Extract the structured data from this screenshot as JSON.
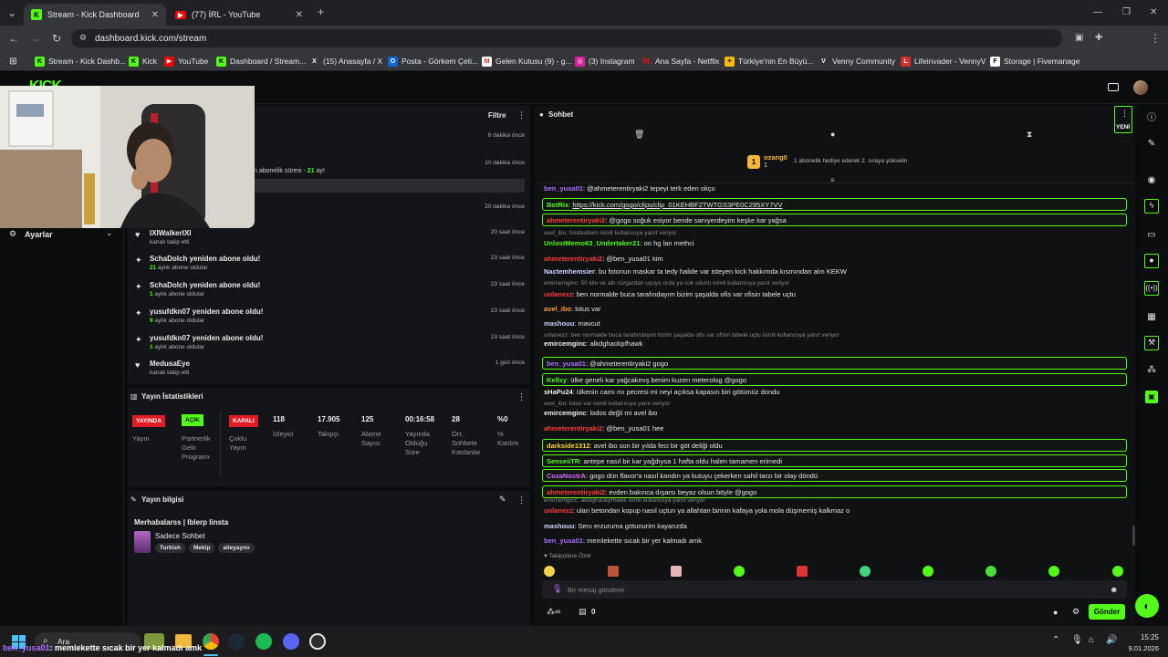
{
  "tabs": [
    {
      "title": "Stream - Kick Dashboard",
      "active": true
    },
    {
      "title": "(77) İRL - YouTube",
      "active": false
    }
  ],
  "address": "dashboard.kick.com/stream",
  "bookmarks": [
    "Stream - Kick Dashb...",
    "Kick",
    "YouTube",
    "Dashboard / Stream...",
    "(15) Anasayfa / X",
    "Posta - Görkem Çeti...",
    "Gelen Kutusu (9) - g...",
    "(3) Instagram",
    "Ana Sayfa - Netflix",
    "Türkiye'nin En Büyü...",
    "Venny Community",
    "Lifeinvader - VennyV",
    "Storage | Fivemanage"
  ],
  "sidebar": {
    "settings_label": "Ayarlar"
  },
  "activity": {
    "filter_label": "Filtre",
    "rows": [
      {
        "time": "6 dakika önce"
      },
      {
        "sub_prefix": "n abonelik süresi - ",
        "sub_num": "21",
        "sub_suffix": " ay!",
        "time": "10 dakika önce"
      },
      {
        "time": "20 dakika önce"
      },
      {
        "title": "IXIWalkerIXI",
        "sub": "kanalı takip etti",
        "time": "20 saat önce"
      },
      {
        "title": "SchaDolch yeniden abone oldu!",
        "sub_num": "21",
        "sub": " aylık abone oldular",
        "time": "23 saat önce"
      },
      {
        "title": "SchaDolch yeniden abone oldu!",
        "sub_num": "1",
        "sub": " aylık abone oldular",
        "time": "23 saat önce"
      },
      {
        "title": "yusufdkn07 yeniden abone oldu!",
        "sub_num": "9",
        "sub": " aylık abone oldular",
        "time": "23 saat önce"
      },
      {
        "title": "yusufdkn07 yeniden abone oldu!",
        "sub_num": "1",
        "sub": " aylık abone oldular",
        "time": "23 saat önce"
      },
      {
        "title": "MedusaEye",
        "sub": "kanalı takip etti",
        "time": "1 gün önce"
      }
    ]
  },
  "stats": {
    "title": "Yayın İstatistikleri",
    "badges": {
      "live": "YAYINDA",
      "partner": "AÇIK",
      "multi": "KAPALI"
    },
    "labels": {
      "stream": "Yayın",
      "partner": "Partnerlik Gelir Programı",
      "multi": "Çoklu Yayın"
    },
    "values": [
      {
        "num": "118",
        "label": "İzleyici"
      },
      {
        "num": "17.905",
        "label": "Takipçi"
      },
      {
        "num": "125",
        "label": "Abone Sayısı"
      },
      {
        "num": "00:16:58",
        "label": "Yayında Olduğu Süre"
      },
      {
        "num": "28",
        "label": "Ort. Sohbete Katılanlar"
      },
      {
        "num": "%0",
        "label": "% Katılım"
      }
    ]
  },
  "info": {
    "title": "Yayın bilgisi",
    "stream_title": "Merhabalarss | Iblerp Iinsta",
    "category": "Sadece Sohbet",
    "tags": [
      "Turkish",
      "Mekip",
      "aileyayını"
    ]
  },
  "chat": {
    "title": "Sohbet",
    "new_label": "YENİ",
    "sub_gift": {
      "user": "ozang0",
      "count": "1",
      "text": "1 abonelik hediye ederek 2. sıraya yükselin"
    },
    "messages": [
      {
        "user": "ben_yusa01",
        "color": "#a970ff",
        "text": "@ahmeterentiryaki2 tepeyi terk eden okçu"
      },
      {
        "user": "BotRix",
        "color": "#53fc18",
        "text": "https://kick.com/gogo/clips/clip_01KEHBF2TWTGS3PE0C295XY7VV",
        "box": true
      },
      {
        "user": "ahmeterentiryaki2",
        "color": "#ff3b3b",
        "text": "@gogo soğuk esiyor bende sanıyerdeyim keşke kar yağsa",
        "box": true
      },
      {
        "reply": "avel_ibo: hosbuldum isimli kullanıcıya yanıt veriyor"
      },
      {
        "user": "UnlostMemo63_Undertaker21",
        "color": "#53fc18",
        "text": "oo hg lan methci"
      },
      {
        "user": "ahmeterentiryaki2",
        "color": "#ff3b3b",
        "text": "@ben_yusa01 kim"
      },
      {
        "user": "Nactemhemsier",
        "color": "#cfd4ff",
        "text": "bu fotonun maskar ta tedy halide var isteyen kick hakkımda kısmından alın KEKW"
      },
      {
        "reply": "emircemginc: 50 kilo ve altı rüzgardan uçuyo orda ya cok sıkıntı isimli kullanıcıya yanıt veriyor"
      },
      {
        "user": "unlanezz",
        "color": "#ff3b3b",
        "text": "ben normalde buca tarafındayım bizim şaşalda ofis var ofisin tabele uçtu"
      },
      {
        "user": "avel_ibo",
        "color": "#ff9a3c",
        "text": "lotus var"
      },
      {
        "user": "mashouu",
        "color": "#cfd4ff",
        "text": "mavcut"
      },
      {
        "reply": "unlanezz: ben normalde buca tarafındayım bizim şaşalda ofis var ofisin tabele uçtu isimli kullanıcıya yanıt veriyor"
      },
      {
        "user": "emircemginc",
        "color": "#f0f0f0",
        "text": "alkdghaolqıfhawk"
      },
      {
        "user": "ben_yusa01",
        "color": "#a970ff",
        "text": "@ahmeterentiryaki2 gogo",
        "box": true
      },
      {
        "user": "Kellsy",
        "color": "#53fc18",
        "text": "ülke geneli kar yağcakmış benim kuzen meterolog @gogo",
        "box": true
      },
      {
        "user": "sHaPu24",
        "color": "#f0f0f0",
        "text": "ülkenin camı mı pecresi mi neyi açıksa kapasın biri götümüz dondu"
      },
      {
        "reply": "avel_ibo: lotus var isimli kullanıcıya yanıt veriyor"
      },
      {
        "user": "emircemginc",
        "color": "#f0f0f0",
        "text": "lodos değli mi avel ibo"
      },
      {
        "user": "ahmeterentiryaki2",
        "color": "#ff3b3b",
        "text": "@ben_yusa01 hee"
      },
      {
        "user": "darkside1312",
        "color": "#ffd23c",
        "text": "avel ibo son bir yılda feci bir göt deliği oldu",
        "box": true
      },
      {
        "user": "SenseiiTR",
        "color": "#53fc18",
        "text": "antepe nasıl bir kar yağdıysa 1 hafta oldu halen tamamen erimedi",
        "box": true
      },
      {
        "user": "CozaNostrA",
        "color": "#d46cff",
        "text": "gogo dün flavor'a nasıl kandın ya kutuyu çekerken sahil tarzı bir olay döndü",
        "box": true
      },
      {
        "user": "ahmeterentiryaki2",
        "color": "#ff3b3b",
        "text": "evden bakınca dışarsı beyaz olsun böyle @gogo",
        "box": true
      },
      {
        "reply": "emircemginc: alkdghaolqıfhawk isimli kullanıcıya yanıt veriyor"
      },
      {
        "user": "unlanezz",
        "color": "#ff3b3b",
        "text": "ulan betondan kopup nasıl uçtun ya allahtan birinin kafaya yola mola düşmemiş kalkmaz o"
      },
      {
        "user": "mashouu",
        "color": "#cfd4ff",
        "text": "Senı erzuruma götunurim kayarızda"
      },
      {
        "user": "ben_yusa01",
        "color": "#a970ff",
        "text": "memlekette sıcak bir yer kalmadı amk"
      }
    ],
    "followers_only": "Takipçilere Özel",
    "input_placeholder": "Bir mesaj gönderin",
    "counter": "0",
    "send_label": "Gönder"
  },
  "taskbar": {
    "search": "Ara",
    "time": "15:25",
    "date": "9.01.2026",
    "overlay_user": "ben_yusa01",
    "overlay_text": ": memlekette sıcak bir yer kalmadı amk"
  }
}
